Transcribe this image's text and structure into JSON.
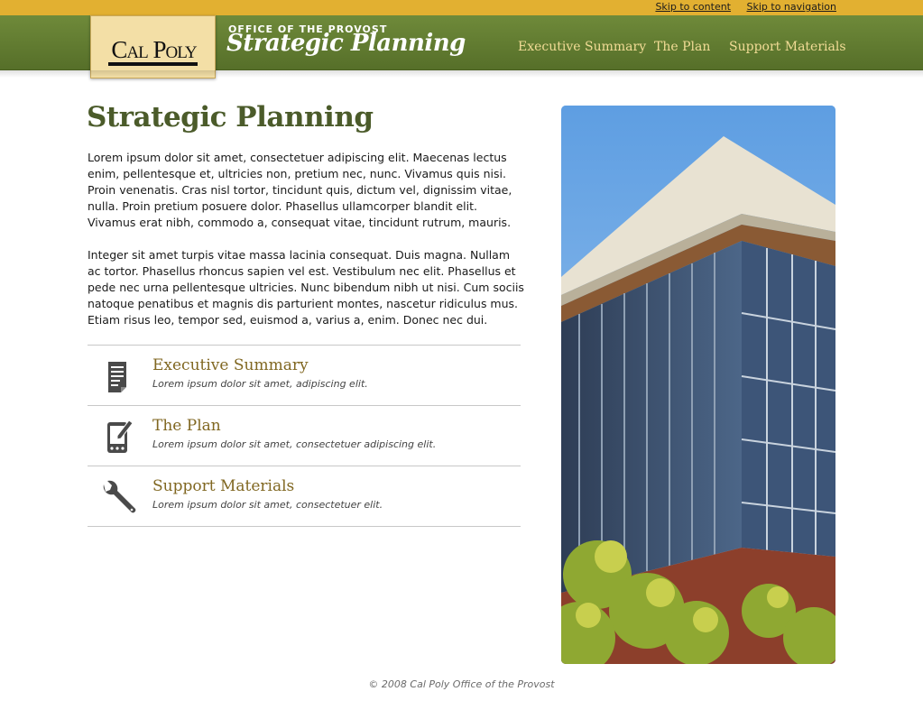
{
  "skip_links": [
    "Skip to content",
    "Skip to navigation"
  ],
  "logo": {
    "text": "Cal Poly"
  },
  "header": {
    "office": "OFFICE OF THE PROVOST",
    "title": "Strategic Planning",
    "nav": [
      "Executive Summary",
      "The Plan",
      "Support Materials"
    ]
  },
  "main": {
    "title": "Strategic Planning",
    "paragraphs": [
      "Lorem ipsum dolor sit amet, consectetuer adipiscing elit. Maecenas lectus enim, pellentesque et, ultricies non, pretium nec, nunc. Vivamus quis nisi. Proin venenatis. Cras nisl tortor, tincidunt quis, dictum vel, dignissim vitae, nulla. Proin pretium posuere dolor. Phasellus ullamcorper blandit elit. Vivamus erat nibh, commodo a, consequat vitae, tincidunt rutrum, mauris.",
      "Integer sit amet turpis vitae massa lacinia consequat. Duis magna. Nullam ac tortor. Phasellus rhoncus sapien vel est. Vestibulum nec elit. Phasellus et pede nec urna pellentesque ultricies. Nunc bibendum nibh ut nisi. Cum sociis natoque penatibus et magnis dis parturient montes, nascetur ridiculus mus. Etiam risus leo, tempor sed, euismod a, varius a, enim. Donec nec dui."
    ],
    "features": [
      {
        "title": "Executive Summary",
        "desc": "Lorem ipsum dolor sit amet, adipiscing elit.",
        "icon": "document-icon"
      },
      {
        "title": "The Plan",
        "desc": "Lorem ipsum dolor sit amet, consectetuer adipiscing elit.",
        "icon": "tablet-pen-icon"
      },
      {
        "title": "Support Materials",
        "desc": "Lorem ipsum dolor sit amet, consectetuer elit.",
        "icon": "wrench-icon"
      }
    ]
  },
  "footer": {
    "text": "© 2008 Cal Poly Office of the Provost"
  },
  "colors": {
    "top_bar": "#e2b031",
    "header_green": "#627c31",
    "nav_text": "#f2dc96",
    "title_green": "#4b5b2a",
    "feature_title": "#806721"
  }
}
